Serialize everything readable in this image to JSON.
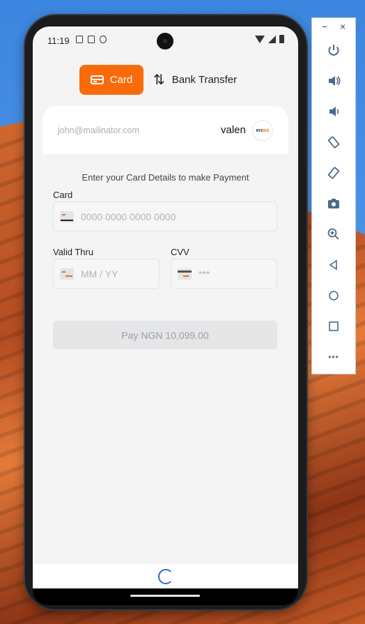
{
  "status": {
    "time": "11:19"
  },
  "tabs": {
    "card_label": "Card",
    "bank_label": "Bank Transfer"
  },
  "panel": {
    "email": "john@mailinator.com",
    "merchant": "valen",
    "logo_text_a": "erc",
    "logo_text_b": "os",
    "instructions": "Enter your Card Details to make Payment"
  },
  "form": {
    "card_label": "Card",
    "card_placeholder": "0000 0000 0000 0000",
    "valid_label": "Valid Thru",
    "valid_placeholder": "MM / YY",
    "cvv_label": "CVV",
    "cvv_placeholder": "***",
    "pay_label": "Pay NGN 10,099.00"
  },
  "toolbar": {
    "minimize": "−",
    "close": "×",
    "more": "•••"
  },
  "colors": {
    "accent": "#f96b0a",
    "disabled_button": "#e5e6e8",
    "spinner": "#2a6cbf"
  }
}
